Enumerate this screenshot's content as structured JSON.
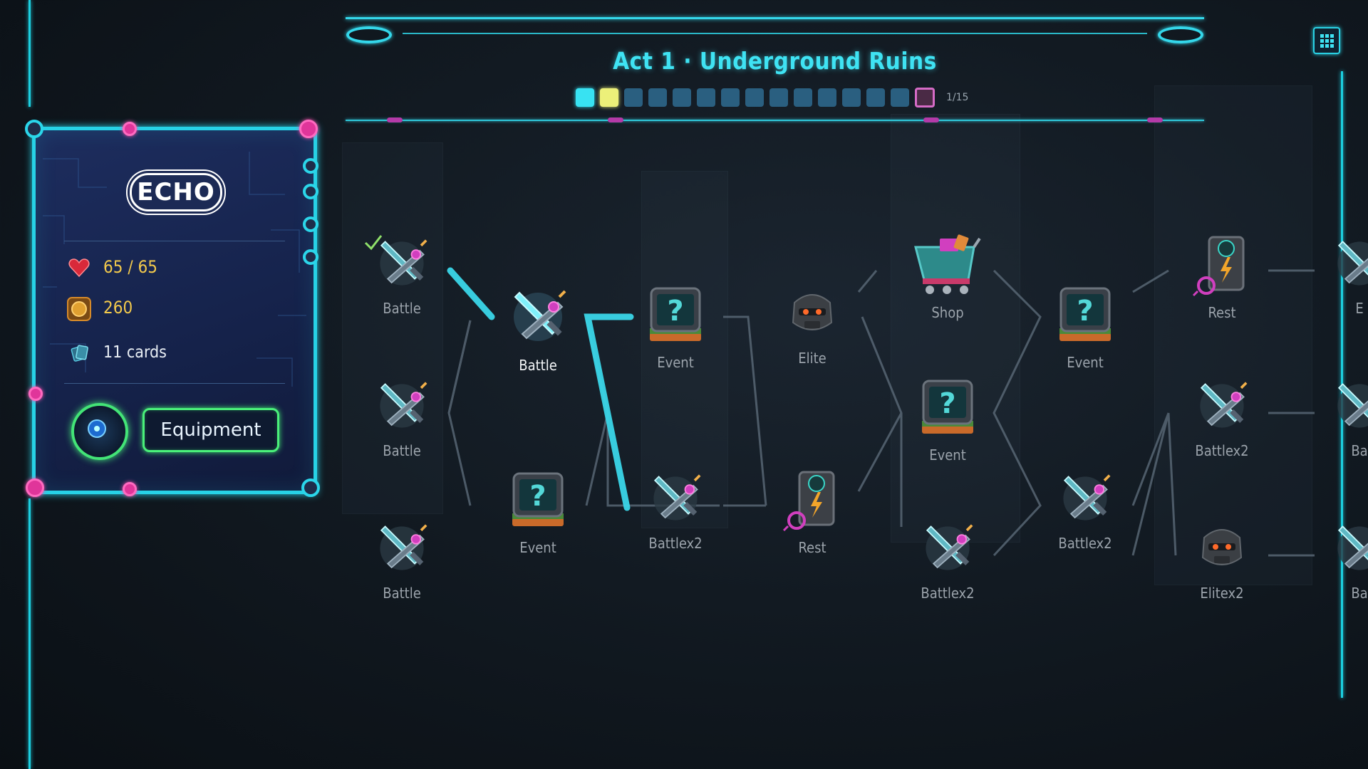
{
  "header": {
    "title": "Act 1 · Underground Ruins",
    "progress_total": 15,
    "progress_done": 1,
    "progress_current": 2,
    "progress_label": "1/15"
  },
  "player": {
    "name": "ECHO",
    "hp": "65 / 65",
    "gold": "260",
    "deck": "11 cards",
    "equipment_button": "Equipment"
  },
  "map": {
    "nodes": [
      {
        "id": "c1a",
        "label": "Battle",
        "type": "battle",
        "completed": true
      },
      {
        "id": "c1b",
        "label": "Battle",
        "type": "battle"
      },
      {
        "id": "c1c",
        "label": "Battle",
        "type": "battle"
      },
      {
        "id": "c2a",
        "label": "Battle",
        "type": "battle",
        "current": true
      },
      {
        "id": "c2b",
        "label": "Event",
        "type": "event"
      },
      {
        "id": "c3a",
        "label": "Event",
        "type": "event"
      },
      {
        "id": "c3b",
        "label": "Battlex2",
        "type": "battle"
      },
      {
        "id": "c4a",
        "label": "Elite",
        "type": "elite"
      },
      {
        "id": "c4b",
        "label": "Rest",
        "type": "rest"
      },
      {
        "id": "c5a",
        "label": "Shop",
        "type": "shop"
      },
      {
        "id": "c5b",
        "label": "Event",
        "type": "event"
      },
      {
        "id": "c5c",
        "label": "Battlex2",
        "type": "battle"
      },
      {
        "id": "c6a",
        "label": "Event",
        "type": "event"
      },
      {
        "id": "c6b",
        "label": "Battlex2",
        "type": "battle"
      },
      {
        "id": "c7a",
        "label": "Rest",
        "type": "rest"
      },
      {
        "id": "c7b",
        "label": "Battlex2",
        "type": "battle"
      },
      {
        "id": "c7c",
        "label": "Elitex2",
        "type": "elite"
      },
      {
        "id": "c8a",
        "label": "E",
        "type": "battle"
      },
      {
        "id": "c8b",
        "label": "Ba",
        "type": "battle"
      },
      {
        "id": "c8c",
        "label": "Ba",
        "type": "battle"
      }
    ]
  },
  "colors": {
    "accent": "#34d7ea",
    "current_step": "#ecf079",
    "boss_step": "#d56bc6",
    "equipment": "#43e477",
    "gold": "#f2c94c"
  },
  "icons": {
    "menu": "grid-icon",
    "hp": "heart-icon",
    "gold": "coin-icon",
    "deck": "cards-icon"
  }
}
